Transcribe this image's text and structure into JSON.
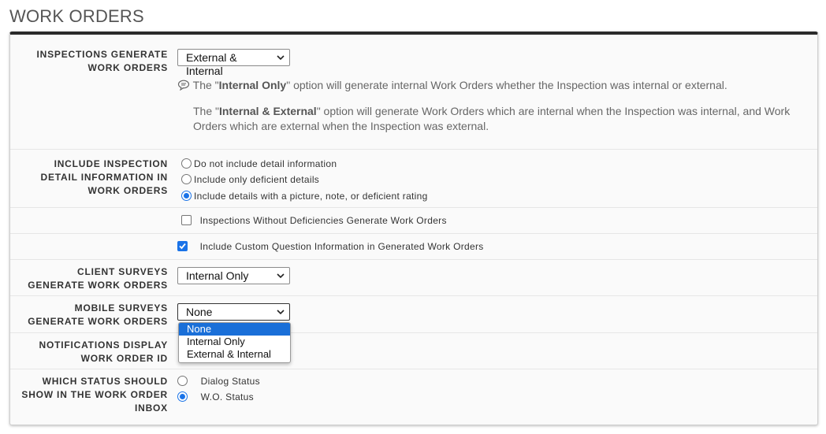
{
  "page": {
    "title": "WORK ORDERS"
  },
  "rows": {
    "inspections_generate": {
      "label": "INSPECTIONS GENERATE WORK ORDERS",
      "select_value": "External & Internal",
      "hint1": {
        "pre": "The \"",
        "bold": "Internal Only",
        "post": "\" option will generate internal Work Orders whether the Inspection was internal or external."
      },
      "hint2": {
        "pre": "The \"",
        "bold": "Internal & External",
        "post": "\" option will generate Work Orders which are internal when the Inspection was internal, and Work Orders which are external when the Inspection was external."
      }
    },
    "include_detail": {
      "label": "INCLUDE INSPECTION DETAIL INFORMATION IN WORK ORDERS",
      "options": [
        {
          "label": "Do not include detail information",
          "selected": false
        },
        {
          "label": "Include only deficient details",
          "selected": false
        },
        {
          "label": "Include details with a picture, note, or deficient rating",
          "selected": true
        }
      ]
    },
    "without_deficiencies": {
      "label": "Inspections Without Deficiencies Generate Work Orders",
      "checked": false
    },
    "custom_question": {
      "label": "Include Custom Question Information in Generated Work Orders",
      "checked": true
    },
    "client_surveys": {
      "label": "CLIENT SURVEYS GENERATE WORK ORDERS",
      "select_value": "Internal Only"
    },
    "mobile_surveys": {
      "label": "MOBILE SURVEYS GENERATE WORK ORDERS",
      "select_value": "None",
      "dropdown_open": true,
      "options": [
        "None",
        "Internal Only",
        "External & Internal"
      ],
      "highlighted": "None"
    },
    "notifications": {
      "label": "NOTIFICATIONS DISPLAY WORK ORDER ID"
    },
    "inbox_status": {
      "label": "WHICH STATUS SHOULD SHOW IN THE WORK ORDER INBOX",
      "options": [
        {
          "label": "Dialog Status",
          "selected": false
        },
        {
          "label": "W.O. Status",
          "selected": true
        }
      ]
    }
  },
  "icons": {
    "chat": "chat-bubble-icon",
    "chevron": "chevron-down-icon"
  },
  "colors": {
    "accent": "#1a73e8",
    "highlight": "#1a6fd8",
    "panel_top": "#2b2b2b"
  }
}
